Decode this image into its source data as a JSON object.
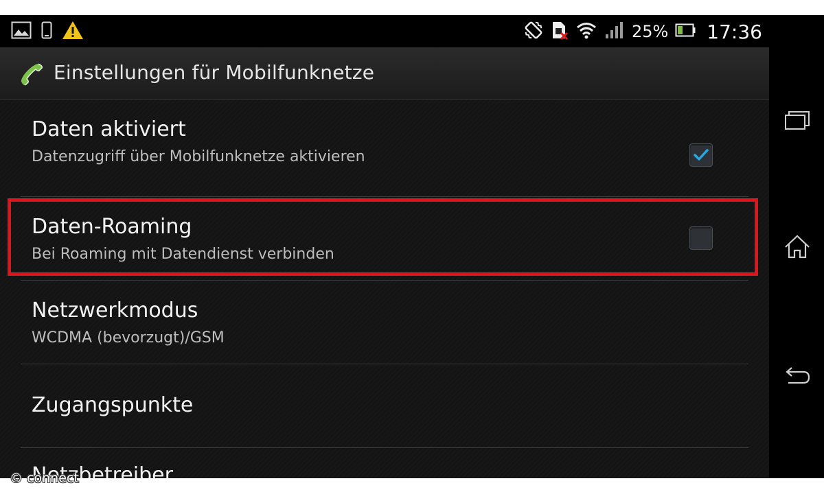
{
  "status_bar": {
    "icons_left": [
      "image-icon",
      "phone-device-icon",
      "warning-icon"
    ],
    "icons_right": [
      "vibrate-icon",
      "sim-icon",
      "wifi-icon",
      "signal-icon"
    ],
    "battery_percent": "25%",
    "clock": "17:36",
    "warning_color": "#f0c419"
  },
  "action_bar": {
    "icon": "phone-handset-icon",
    "title": "Einstellungen für Mobilfunknetze"
  },
  "settings": [
    {
      "title": "Daten aktiviert",
      "summary": "Datenzugriff über Mobilfunknetze aktivieren",
      "checkbox": true,
      "checked": true
    },
    {
      "title": "Daten-Roaming",
      "summary": "Bei Roaming mit Datendienst verbinden",
      "checkbox": true,
      "checked": false
    },
    {
      "title": "Netzwerkmodus",
      "summary": "WCDMA (bevorzugt)/GSM",
      "checkbox": false
    },
    {
      "title": "Zugangspunkte",
      "summary": "",
      "checkbox": false
    },
    {
      "title": "Netzbetreiber",
      "summary": "",
      "checkbox": false
    }
  ],
  "nav_bar": {
    "buttons": [
      "recent-apps-icon",
      "home-icon",
      "back-icon"
    ]
  },
  "highlight_color": "#e0141c",
  "accent_color": "#2aa7e0",
  "watermark": "© connect"
}
